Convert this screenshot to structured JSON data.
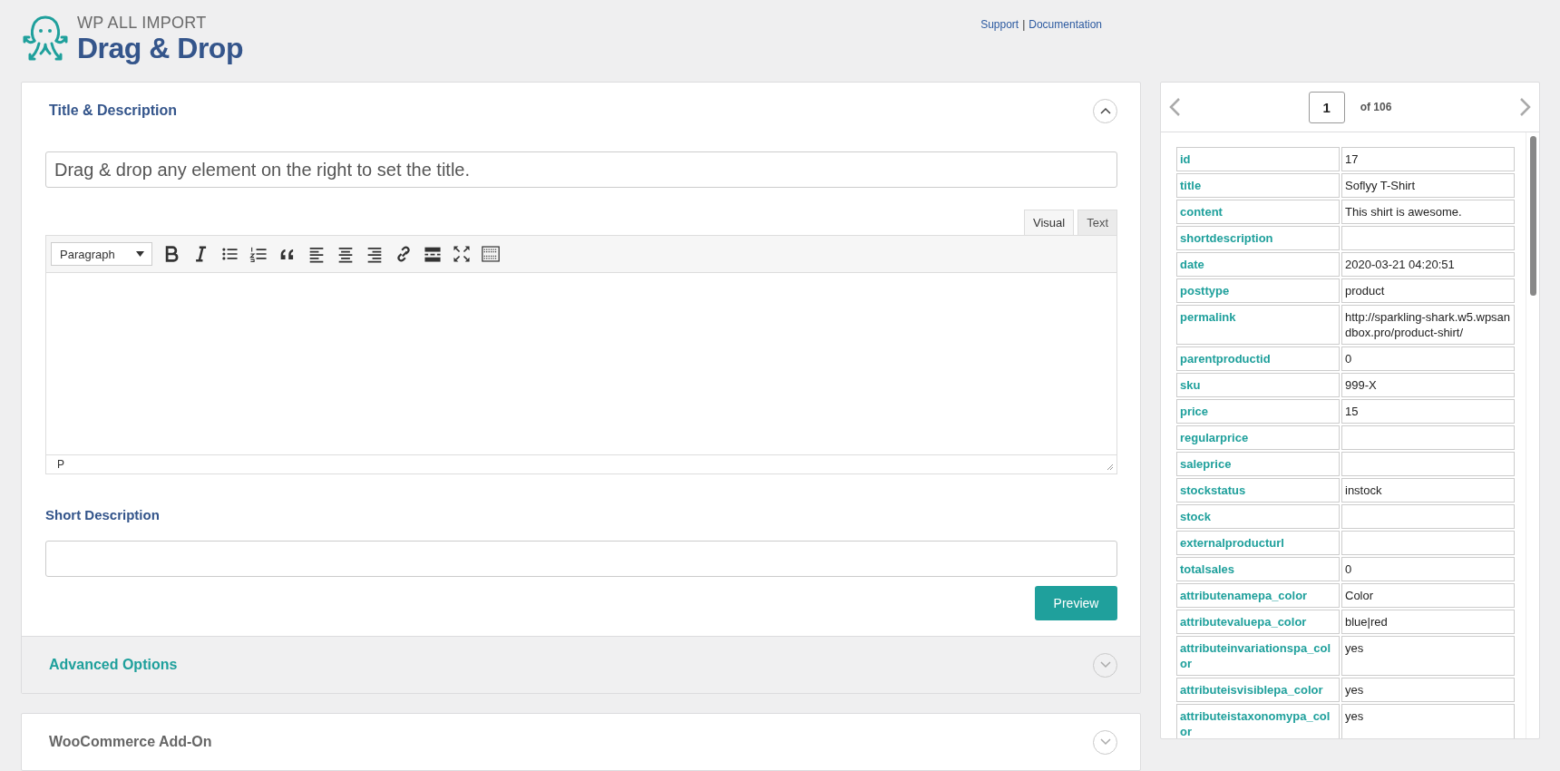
{
  "header": {
    "logo_subtitle": "WP ALL IMPORT",
    "logo_title": "Drag & Drop",
    "links": [
      "Support",
      "Documentation"
    ],
    "link_separator": "|"
  },
  "title_section": {
    "heading": "Title & Description",
    "expanded": true,
    "title_field": {
      "placeholder": "Drag & drop any element on the right to set the title."
    },
    "editor": {
      "tabs": [
        {
          "label": "Visual",
          "selected": true
        },
        {
          "label": "Text",
          "selected": false
        }
      ],
      "format_select": "Paragraph",
      "status_path": "P"
    },
    "short_description": {
      "label": "Short Description"
    },
    "preview_button": "Preview"
  },
  "advanced_options": {
    "heading": "Advanced Options",
    "expanded": false
  },
  "woocommerce_addon": {
    "heading": "WooCommerce Add-On",
    "expanded": false
  },
  "record_viewer": {
    "page": "1",
    "page_total": "of 106",
    "fields": [
      {
        "key": "id",
        "value": "17"
      },
      {
        "key": "title",
        "value": "Soflyy T-Shirt"
      },
      {
        "key": "content",
        "value": "This shirt is awesome."
      },
      {
        "key": "shortdescription"
      },
      {
        "key": "date",
        "value": "2020-03-21 04:20:51"
      },
      {
        "key": "posttype",
        "value": "product"
      },
      {
        "key": "permalink",
        "value": "http://sparkling-shark.w5.wpsandbox.pro/product-shirt/"
      },
      {
        "key": "parentproductid",
        "value": "0"
      },
      {
        "key": "sku",
        "value": "999-X"
      },
      {
        "key": "price",
        "value": "15"
      },
      {
        "key": "regularprice"
      },
      {
        "key": "saleprice"
      },
      {
        "key": "stockstatus",
        "value": "instock"
      },
      {
        "key": "stock"
      },
      {
        "key": "externalproducturl"
      },
      {
        "key": "totalsales",
        "value": "0"
      },
      {
        "key": "attributenamepa_color",
        "value": "Color"
      },
      {
        "key": "attributevaluepa_color",
        "value": "blue|red"
      },
      {
        "key": "attributeinvariationspa_color",
        "value": "yes"
      },
      {
        "key": "attributeisvisiblepa_color",
        "value": "yes"
      },
      {
        "key": "attributeistaxonomypa_color",
        "value": "yes"
      }
    ]
  }
}
